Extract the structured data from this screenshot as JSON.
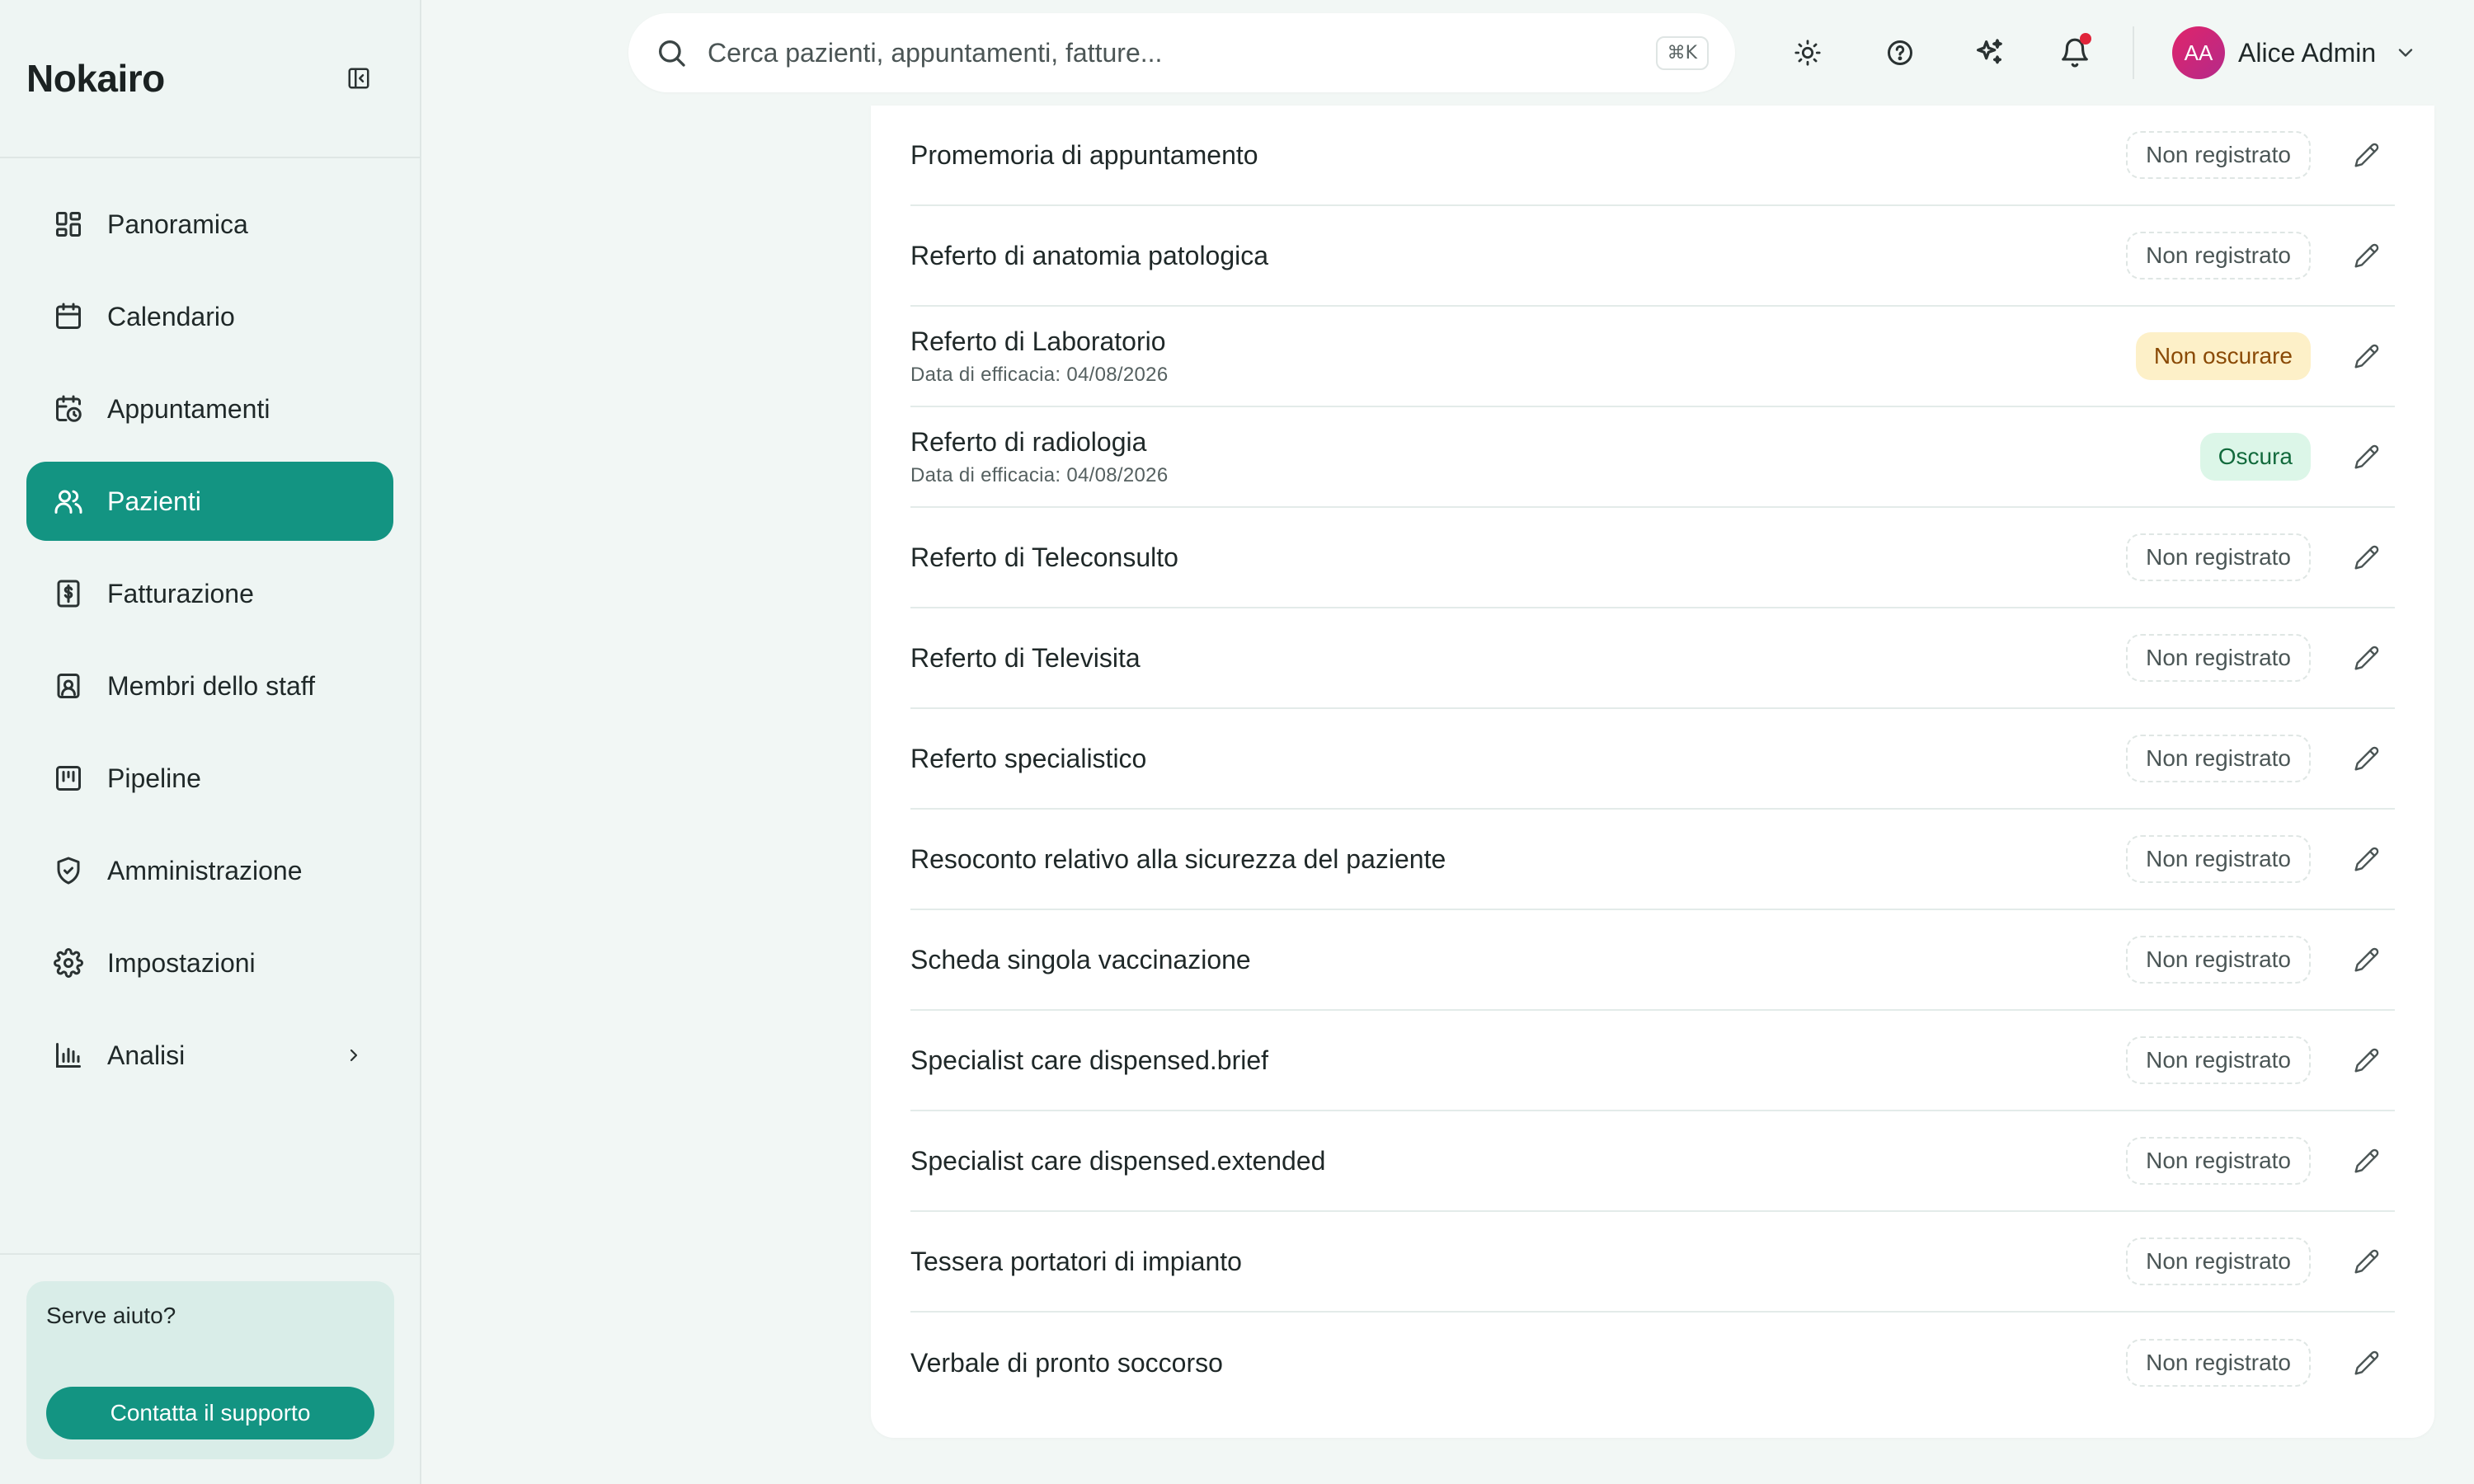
{
  "brand": "Nokairo",
  "sidebar": {
    "items": [
      {
        "label": "Panoramica",
        "icon": "dashboard-icon"
      },
      {
        "label": "Calendario",
        "icon": "calendar-icon"
      },
      {
        "label": "Appuntamenti",
        "icon": "calendar-clock-icon"
      },
      {
        "label": "Pazienti",
        "icon": "users-icon",
        "active": true
      },
      {
        "label": "Fatturazione",
        "icon": "invoice-icon"
      },
      {
        "label": "Membri dello staff",
        "icon": "staff-badge-icon"
      },
      {
        "label": "Pipeline",
        "icon": "kanban-icon"
      },
      {
        "label": "Amministrazione",
        "icon": "shield-check-icon"
      },
      {
        "label": "Impostazioni",
        "icon": "gear-icon"
      },
      {
        "label": "Analisi",
        "icon": "bar-chart-icon",
        "has_submenu": true
      }
    ],
    "help": {
      "title": "Serve aiuto?",
      "button": "Contatta il supporto"
    }
  },
  "header": {
    "search_placeholder": "Cerca pazienti, appuntamenti, fatture...",
    "search_shortcut": "⌘K",
    "user": {
      "initials": "AA",
      "name": "Alice Admin"
    }
  },
  "documents": [
    {
      "title": "Promemoria di appuntamento",
      "status": "Non registrato",
      "variant": "neutral"
    },
    {
      "title": "Referto di anatomia patologica",
      "status": "Non registrato",
      "variant": "neutral"
    },
    {
      "title": "Referto di Laboratorio",
      "subtitle": "Data di efficacia: 04/08/2026",
      "status": "Non oscurare",
      "variant": "warn"
    },
    {
      "title": "Referto di radiologia",
      "subtitle": "Data di efficacia: 04/08/2026",
      "status": "Oscura",
      "variant": "ok"
    },
    {
      "title": "Referto di Teleconsulto",
      "status": "Non registrato",
      "variant": "neutral"
    },
    {
      "title": "Referto di Televisita",
      "status": "Non registrato",
      "variant": "neutral"
    },
    {
      "title": "Referto specialistico",
      "status": "Non registrato",
      "variant": "neutral"
    },
    {
      "title": "Resoconto relativo alla sicurezza del paziente",
      "status": "Non registrato",
      "variant": "neutral"
    },
    {
      "title": "Scheda singola vaccinazione",
      "status": "Non registrato",
      "variant": "neutral"
    },
    {
      "title": "Specialist care dispensed.brief",
      "status": "Non registrato",
      "variant": "neutral"
    },
    {
      "title": "Specialist care dispensed.extended",
      "status": "Non registrato",
      "variant": "neutral"
    },
    {
      "title": "Tessera portatori di impianto",
      "status": "Non registrato",
      "variant": "neutral"
    },
    {
      "title": "Verbale di pronto soccorso",
      "status": "Non registrato",
      "variant": "neutral"
    }
  ],
  "colors": {
    "accent": "#139482",
    "notification": "#e0243a"
  }
}
